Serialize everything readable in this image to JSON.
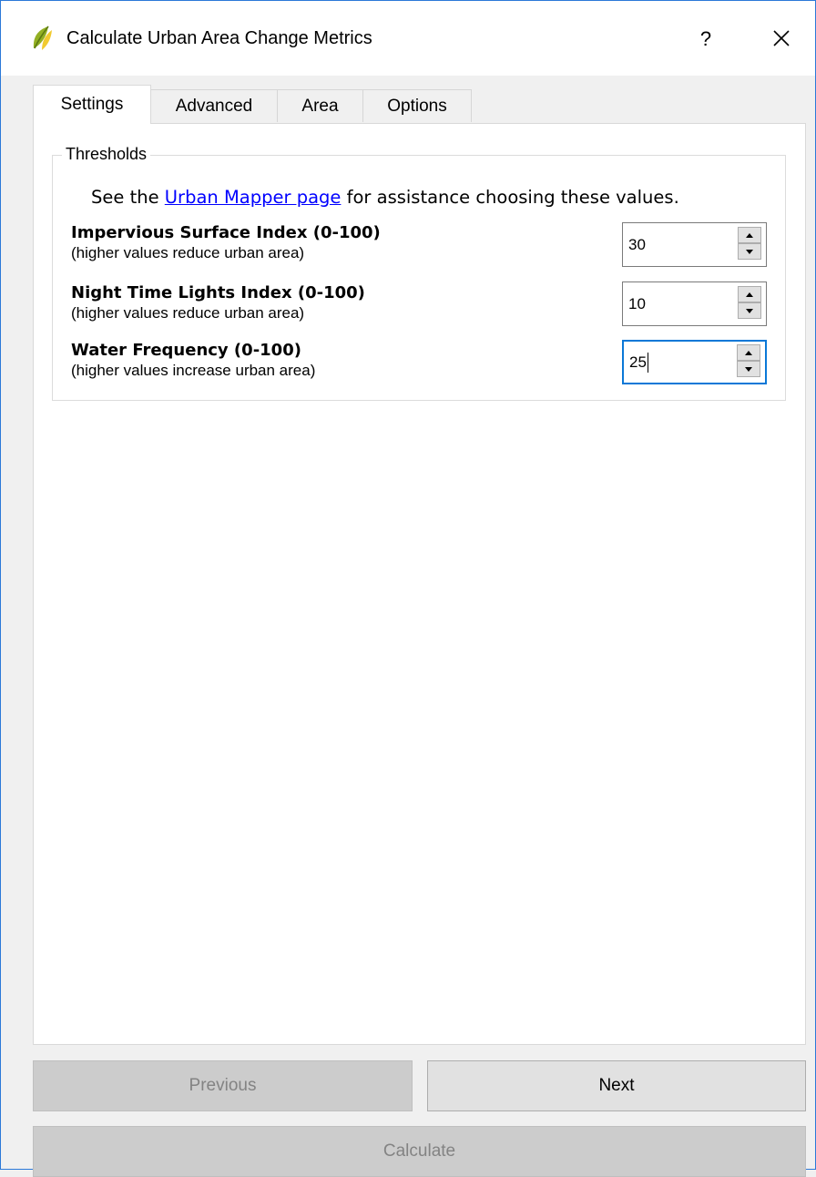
{
  "window": {
    "title": "Calculate Urban Area Change Metrics",
    "help_label": "?",
    "close_label": "×"
  },
  "tabs": [
    {
      "label": "Settings",
      "active": true
    },
    {
      "label": "Advanced",
      "active": false
    },
    {
      "label": "Area",
      "active": false
    },
    {
      "label": "Options",
      "active": false
    }
  ],
  "thresholds": {
    "group_title": "Thresholds",
    "help_prefix": "See the ",
    "help_link": "Urban Mapper page",
    "help_suffix": " for assistance choosing these values.",
    "fields": [
      {
        "title": "Impervious Surface Index (0-100)",
        "subtitle": "(higher values reduce urban area)",
        "value": "30"
      },
      {
        "title": "Night Time Lights Index (0-100)",
        "subtitle": "(higher values reduce urban area)",
        "value": "10"
      },
      {
        "title": "Water Frequency (0-100)",
        "subtitle": "(higher values increase urban area)",
        "value": "25"
      }
    ]
  },
  "buttons": {
    "previous": "Previous",
    "next": "Next",
    "calculate": "Calculate"
  },
  "colors": {
    "accent": "#0a78d7",
    "link": "#0000ff",
    "disabled_bg": "#cccccc"
  }
}
